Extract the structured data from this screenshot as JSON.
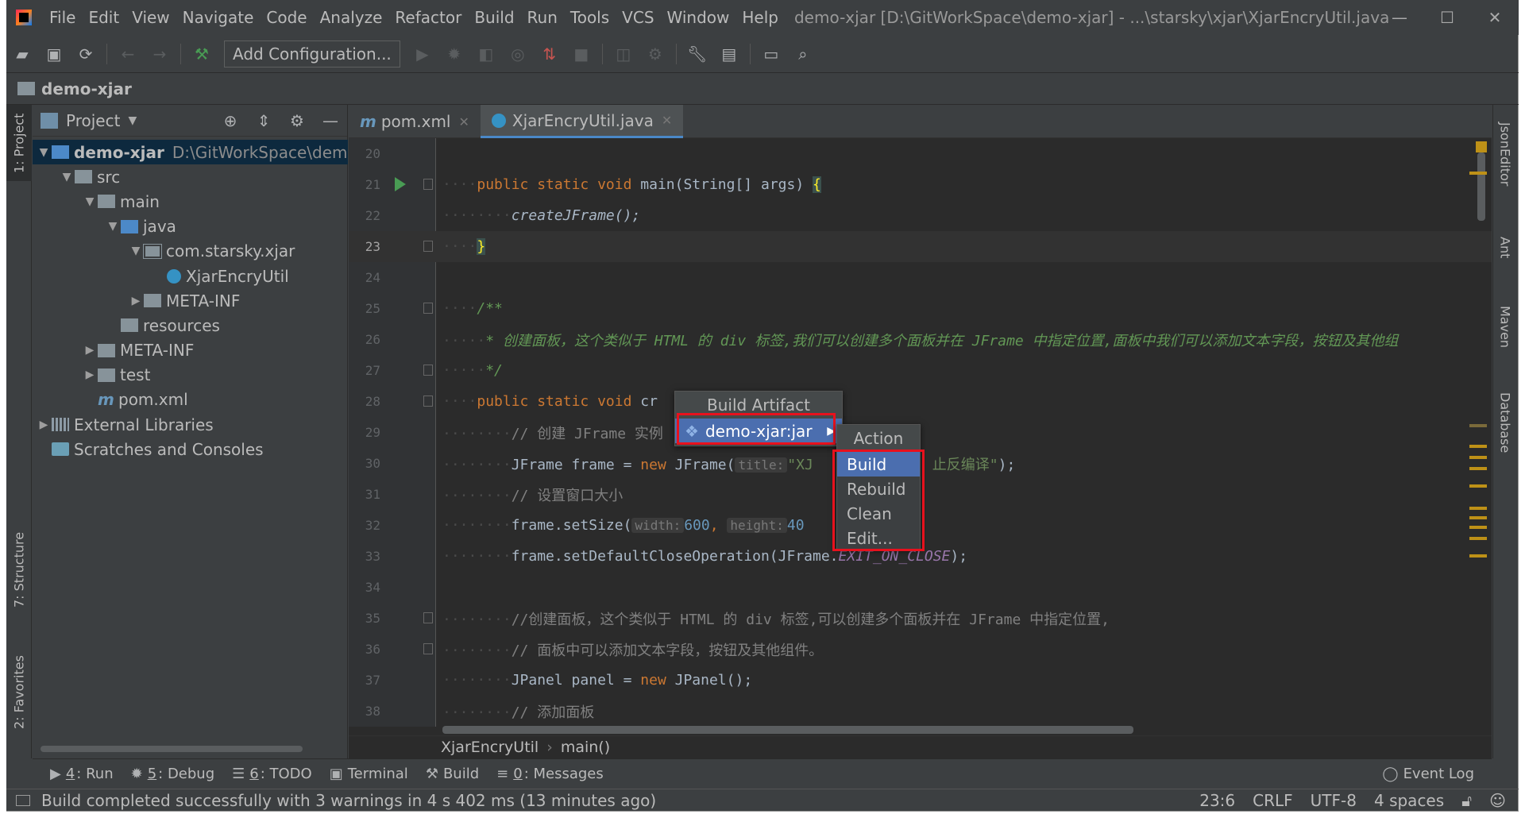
{
  "titlebar": {
    "menu": [
      "File",
      "Edit",
      "View",
      "Navigate",
      "Code",
      "Analyze",
      "Refactor",
      "Build",
      "Run",
      "Tools",
      "VCS",
      "Window",
      "Help"
    ],
    "title": "demo-xjar [D:\\GitWorkSpace\\demo-xjar] - ...\\starsky\\xjar\\XjarEncryUtil.java"
  },
  "toolbar": {
    "add_config": "Add Configuration..."
  },
  "navbar": {
    "project": "demo-xjar"
  },
  "left_stripe": {
    "project_tab": "1: Project",
    "structure_tab": "7: Structure",
    "favorites_tab": "2: Favorites"
  },
  "right_stripe": {
    "json_tab": "JsonEditor",
    "ant_tab": "Ant",
    "maven_tab": "Maven",
    "db_tab": "Database"
  },
  "project_panel": {
    "title": "Project",
    "tree": [
      {
        "label": "demo-xjar",
        "path": "D:\\GitWorkSpace\\dem",
        "indent": 0,
        "arrow": "▼",
        "icon": "src",
        "bold": true,
        "selected": true
      },
      {
        "label": "src",
        "indent": 1,
        "arrow": "▼",
        "icon": "dir"
      },
      {
        "label": "main",
        "indent": 2,
        "arrow": "▼",
        "icon": "dir"
      },
      {
        "label": "java",
        "indent": 3,
        "arrow": "▼",
        "icon": "src"
      },
      {
        "label": "com.starsky.xjar",
        "indent": 4,
        "arrow": "▼",
        "icon": "pkg"
      },
      {
        "label": "XjarEncryUtil",
        "indent": 5,
        "arrow": "",
        "icon": "java"
      },
      {
        "label": "META-INF",
        "indent": 4,
        "arrow": "▶",
        "icon": "dir"
      },
      {
        "label": "resources",
        "indent": 3,
        "arrow": "",
        "icon": "dir"
      },
      {
        "label": "META-INF",
        "indent": 2,
        "arrow": "▶",
        "icon": "dir"
      },
      {
        "label": "test",
        "indent": 2,
        "arrow": "▶",
        "icon": "dir"
      },
      {
        "label": "pom.xml",
        "indent": 2,
        "arrow": "",
        "icon": "mvn"
      },
      {
        "label": "External Libraries",
        "indent": 0,
        "arrow": "▶",
        "icon": "lib"
      },
      {
        "label": "Scratches and Consoles",
        "indent": 0,
        "arrow": "",
        "icon": "scr"
      }
    ]
  },
  "editor": {
    "tabs": [
      {
        "label": "pom.xml",
        "active": false
      },
      {
        "label": "XjarEncryUtil.java",
        "active": true
      }
    ],
    "line_numbers": [
      "20",
      "21",
      "22",
      "23",
      "24",
      "25",
      "26",
      "27",
      "28",
      "29",
      "30",
      "31",
      "32",
      "33",
      "34",
      "35",
      "36",
      "37",
      "38"
    ],
    "code": {
      "l21_kw": "public static void ",
      "l21_rest": "main(String[] args) ",
      "l21_brace": "{",
      "l22": "createJFrame();",
      "l23_brace": "}",
      "l25": "/**",
      "l26": "* 创建面板，这个类似于 HTML 的 div 标签,我们可以创建多个面板并在 JFrame 中指定位置,面板中我们可以添加文本字段，按钮及其他组",
      "l27": "*/",
      "l28_kw": "public static void ",
      "l28_rest": "cr",
      "l29": "// 创建 JFrame 实例",
      "l30_a": "JFrame frame = ",
      "l30_kw": "new ",
      "l30_b": "JFrame(",
      "l30_hint": "title:",
      "l30_str": "\"XJ",
      "l30_str2": "止反编译\"",
      "l30_end": ");",
      "l31": "// 设置窗口大小",
      "l32_a": "frame.setSize(",
      "l32_hint1": "width:",
      "l32_n1": "600",
      "l32_c": ", ",
      "l32_hint2": "height:",
      "l32_n2": "40",
      "l33_a": "frame.setDefaultCloseOperation(JFrame.",
      "l33_const": "EXIT_ON_CLOSE",
      "l33_end": ");",
      "l35": "//创建面板，这个类似于 HTML 的 div 标签,可以创建多个面板并在 JFrame 中指定位置,",
      "l36": "// 面板中可以添加文本字段，按钮及其他组件。",
      "l37_a": "JPanel panel = ",
      "l37_kw": "new ",
      "l37_b": "JPanel();",
      "l38": "// 添加面板"
    },
    "breadcrumb": [
      "XjarEncryUtil",
      "main()"
    ]
  },
  "build_artifact_popup": {
    "header": "Build Artifact",
    "item": "demo-xjar:jar"
  },
  "action_popup": {
    "header": "Action",
    "items": [
      "Build",
      "Rebuild",
      "Clean",
      "Edit..."
    ],
    "selected": "Build"
  },
  "bottom_tools": [
    {
      "icon": "▶",
      "key": "4",
      "label": ": Run"
    },
    {
      "icon": "✹",
      "key": "5",
      "label": ": Debug"
    },
    {
      "icon": "☰",
      "key": "6",
      "label": ": TODO"
    },
    {
      "icon": "▣",
      "key": "",
      "label": "Terminal"
    },
    {
      "icon": "⚒",
      "key": "",
      "label": "Build"
    },
    {
      "icon": "≡",
      "key": "0",
      "label": ": Messages"
    }
  ],
  "event_log": "Event Log",
  "status": {
    "message": "Build completed successfully with 3 warnings in 4 s 402 ms (13 minutes ago)",
    "position": "23:6",
    "line_sep": "CRLF",
    "encoding": "UTF-8",
    "indent": "4 spaces"
  },
  "colors": {
    "accent": "#4b6eaf",
    "highlight_box": "#e8111d",
    "background": "#2b2b2b"
  }
}
